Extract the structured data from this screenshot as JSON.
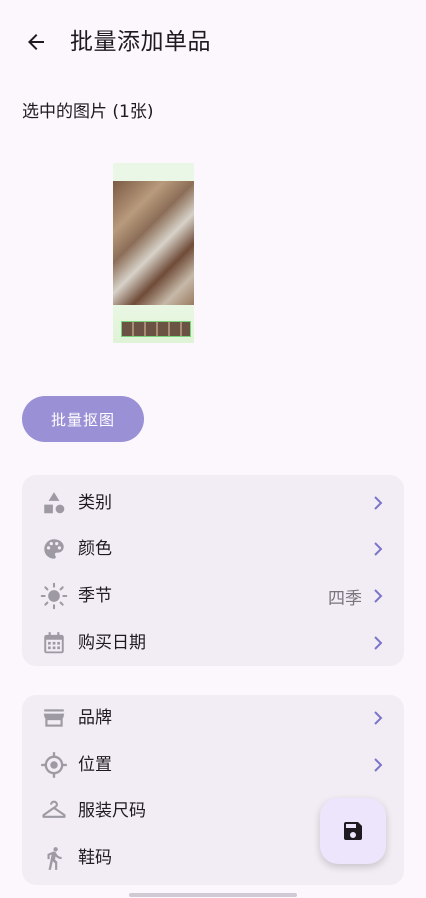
{
  "appbar": {
    "title": "批量添加单品",
    "back_icon": "arrow-back-icon"
  },
  "selected": {
    "heading": "选中的图片 (1张)"
  },
  "actions": {
    "cutout_label": "批量抠图"
  },
  "card1": {
    "rows": [
      {
        "label": "类别",
        "value": "",
        "icon": "category-shapes-icon"
      },
      {
        "label": "颜色",
        "value": "",
        "icon": "palette-icon"
      },
      {
        "label": "季节",
        "value": "四季",
        "icon": "sun-icon"
      },
      {
        "label": "购买日期",
        "value": "",
        "icon": "calendar-icon"
      }
    ]
  },
  "card2": {
    "rows": [
      {
        "label": "品牌",
        "value": "",
        "icon": "store-icon"
      },
      {
        "label": "位置",
        "value": "",
        "icon": "location-target-icon"
      },
      {
        "label": "服装尺码",
        "value": "",
        "icon": "hanger-icon"
      },
      {
        "label": "鞋码",
        "value": "",
        "icon": "walking-icon"
      }
    ]
  },
  "fab": {
    "icon": "save-icon"
  },
  "colors": {
    "accent": "#9a90d6",
    "chevron": "#7b74c9",
    "icon_gray": "#9e9aa3",
    "card_bg": "#f2edf4",
    "page_bg": "#fcf6fd"
  }
}
